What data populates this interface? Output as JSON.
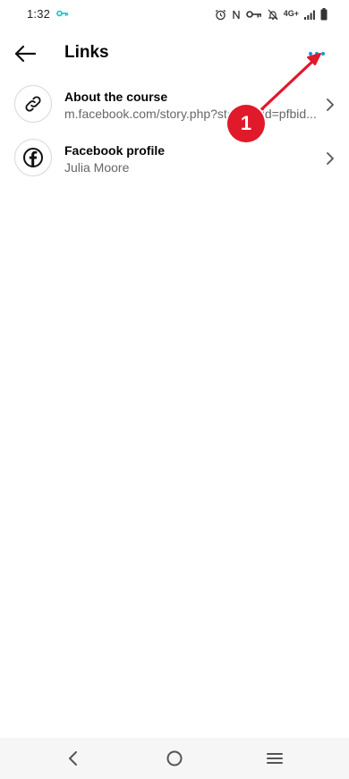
{
  "status_bar": {
    "time": "1:32",
    "network": "4G+",
    "icons": [
      "key-icon",
      "alarm-icon",
      "nfc-icon",
      "vpn-key-icon",
      "mute-bell-icon",
      "signal-icon",
      "battery-icon"
    ],
    "key_color": "#10c4c4"
  },
  "header": {
    "title": "Links",
    "back_icon": "arrow-left-icon",
    "more_icon": "more-dots-icon",
    "more_color": "#1a9ad6"
  },
  "links": [
    {
      "title": "About the course",
      "subtitle": "m.facebook.com/story.php?story_fbid=pfbid...",
      "icon": "link-icon"
    },
    {
      "title": "Facebook profile",
      "subtitle": "Julia Moore",
      "icon": "facebook-icon"
    }
  ],
  "annotation": {
    "number": "1",
    "color": "#e0192b"
  },
  "nav_bar": {
    "icons": [
      "nav-back-icon",
      "nav-home-icon",
      "nav-menu-icon"
    ]
  }
}
